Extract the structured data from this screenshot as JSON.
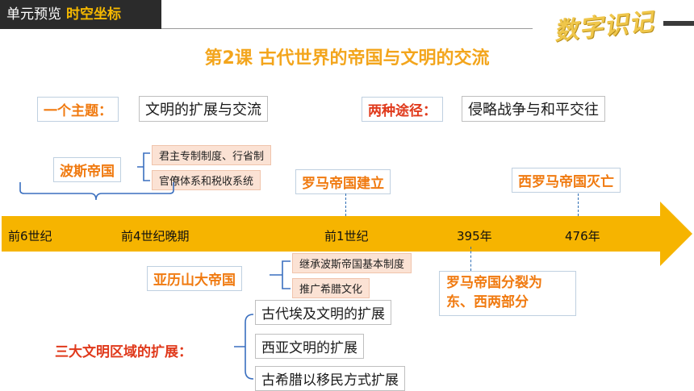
{
  "header": {
    "label": "单元预览",
    "highlight": "时空坐标",
    "brand": "数字识记"
  },
  "title": "第2课 古代世界的帝国与文明的交流",
  "theme": {
    "label": "一个主题：",
    "value": "文明的扩展与交流"
  },
  "paths": {
    "label": "两种途径：",
    "value": "侵略战争与和平交往"
  },
  "persia": {
    "name": "波斯帝国",
    "items": [
      "君主专制制度、行省制",
      "官僚体系和税收系统"
    ]
  },
  "rome_founded": "罗马帝国建立",
  "west_rome_fall": "西罗马帝国灭亡",
  "timeline": {
    "ticks": [
      "前6世纪",
      "前4世纪晚期",
      "前1世纪",
      "395年",
      "476年"
    ]
  },
  "alexander": {
    "name": "亚历山大帝国",
    "items": [
      "继承波斯帝国基本制度",
      "推广希腊文化"
    ]
  },
  "rome_split": {
    "line1": "罗马帝国分裂为",
    "line2": "东、西两部分"
  },
  "civilizations": {
    "label": "三大文明区域的扩展：",
    "items": [
      "古代埃及文明的扩展",
      "西亚文明的扩展",
      "古希腊以移民方式扩展"
    ]
  },
  "colors": {
    "arrow": "#f6b400",
    "orange_text": "#f07a10",
    "red_text": "#e0391b",
    "bracket": "#3a6fbf",
    "peach": "#fbe2d4"
  }
}
